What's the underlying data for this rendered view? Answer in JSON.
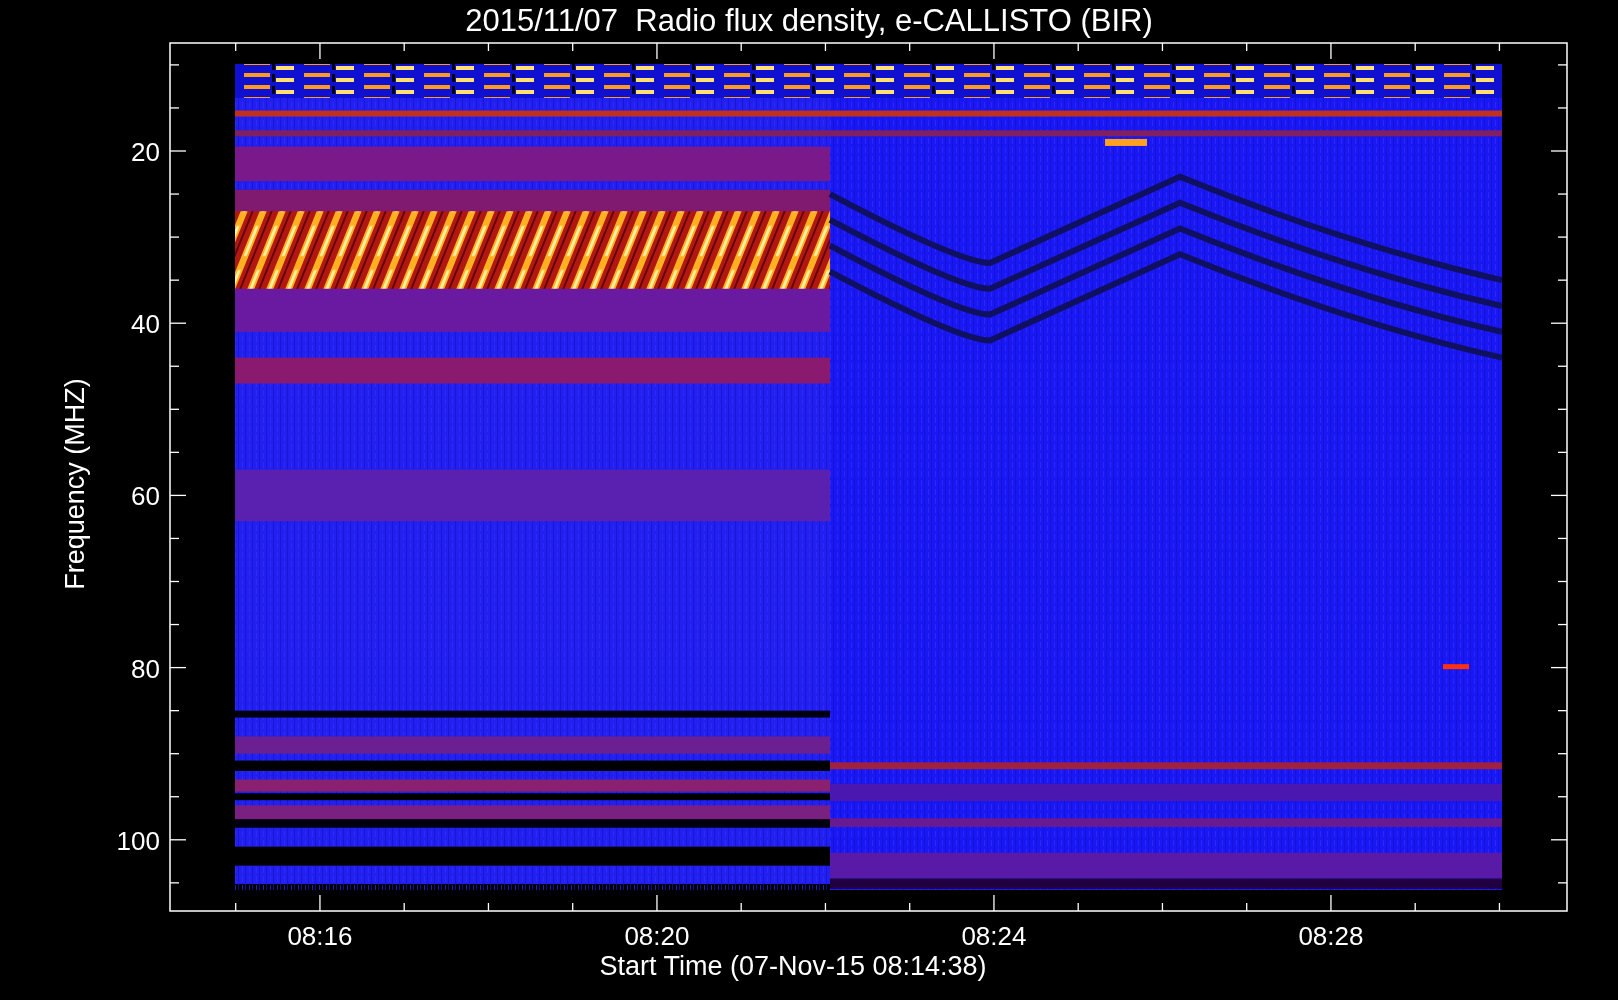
{
  "title": "2015/11/07  Radio flux density, e-CALLISTO (BIR)",
  "y_axis": {
    "label": "Frequency (MHZ)",
    "ticks": [
      "20",
      "40",
      "60",
      "80",
      "100"
    ]
  },
  "x_axis": {
    "label": "Start Time (07-Nov-15 08:14:38)",
    "ticks": [
      "08:16",
      "08:20",
      "08:24",
      "08:28"
    ]
  }
}
